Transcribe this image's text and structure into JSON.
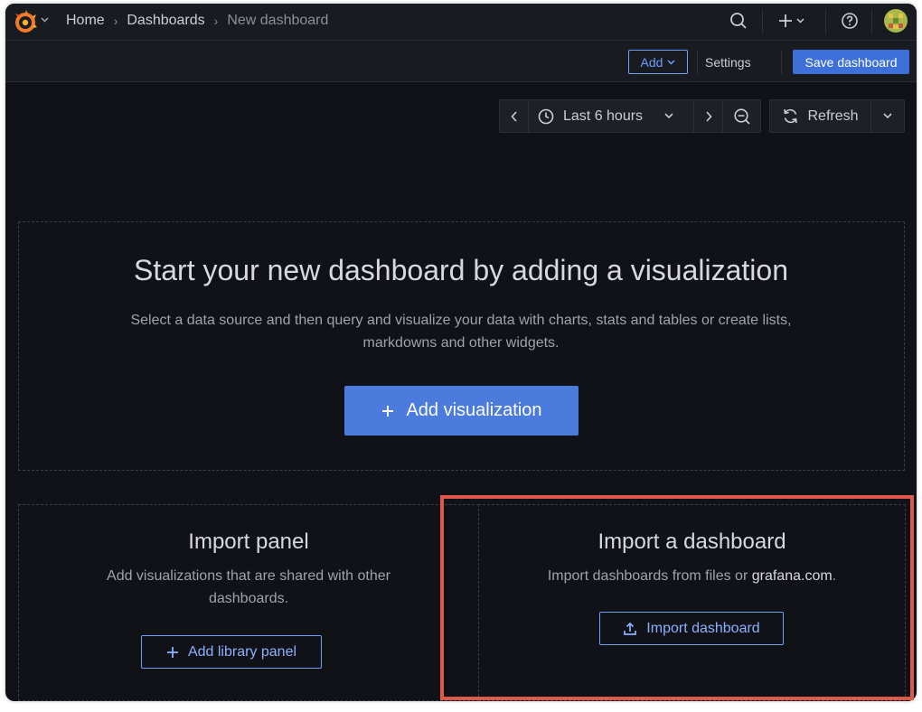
{
  "breadcrumb": {
    "home": "Home",
    "dashboards": "Dashboards",
    "current": "New dashboard"
  },
  "topbar": {
    "logo_icon": "grafana-logo",
    "search_icon": "search-icon",
    "new_icon": "plus-icon",
    "help_icon": "help-icon"
  },
  "toolbar": {
    "add_label": "Add",
    "settings_label": "Settings",
    "save_label": "Save dashboard"
  },
  "time_controls": {
    "range_label": "Last 6 hours",
    "refresh_label": "Refresh"
  },
  "empty_state": {
    "title": "Start your new dashboard by adding a visualization",
    "description_line1": "Select a data source and then query and visualize your data with charts, stats and tables or create lists,",
    "description_line2": "markdowns and other widgets.",
    "add_visualization_label": "Add visualization"
  },
  "import_panel": {
    "title": "Import panel",
    "description_line1": "Add visualizations that are shared with other",
    "description_line2": "dashboards.",
    "button_label": "Add library panel"
  },
  "import_dashboard": {
    "title": "Import a dashboard",
    "description_prefix": "Import dashboards from files or ",
    "description_link": "grafana.com",
    "description_suffix": ".",
    "button_label": "Import dashboard"
  },
  "colors": {
    "primary": "#3d71d9",
    "primary_text": "#6e9fff",
    "background": "#111217",
    "highlight": "#e0584a",
    "logo_orange": "#f05a28"
  }
}
